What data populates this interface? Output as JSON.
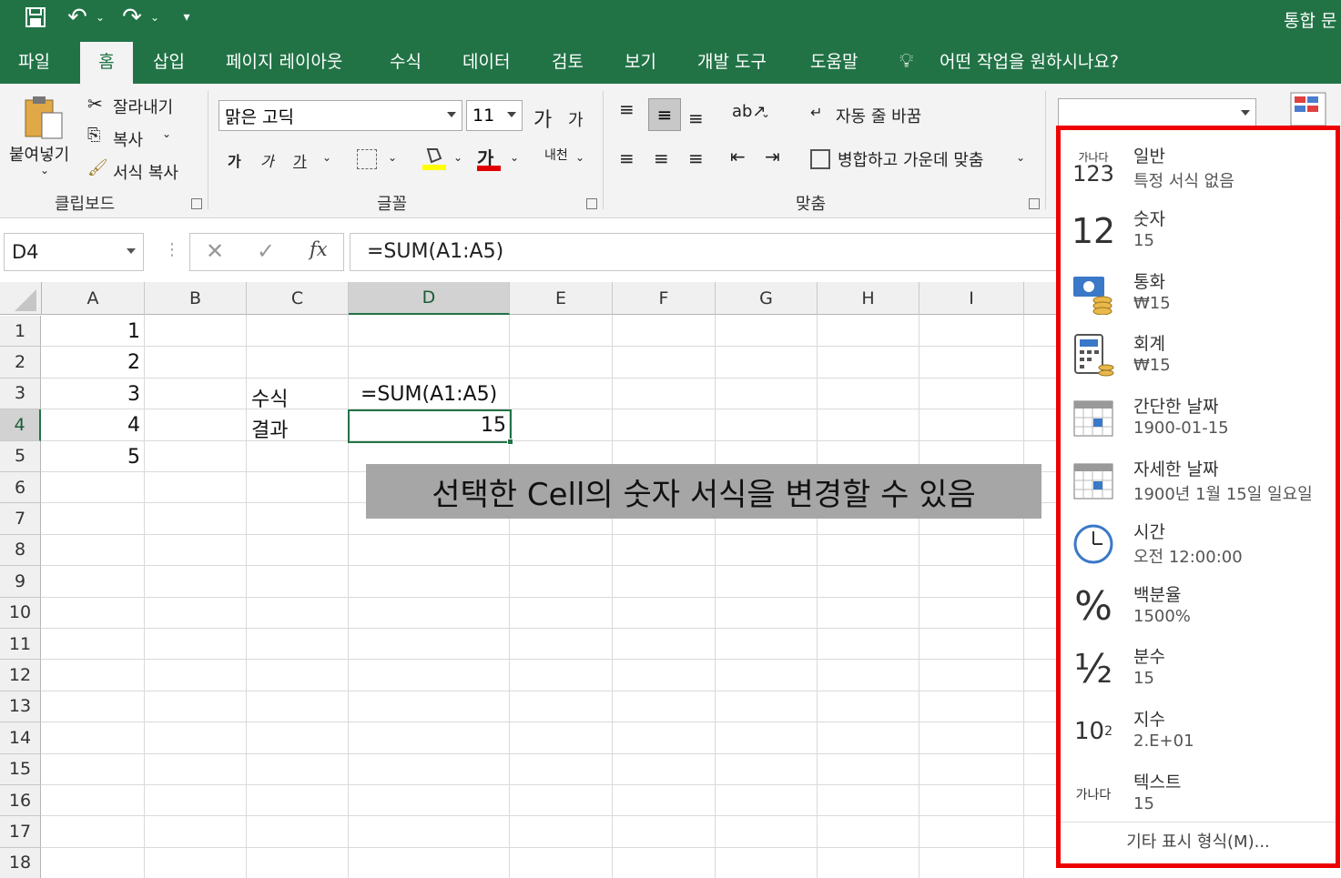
{
  "title_right": "통합 문",
  "tabs": [
    "파일",
    "홈",
    "삽입",
    "페이지 레이아웃",
    "수식",
    "데이터",
    "검토",
    "보기",
    "개발 도구",
    "도움말"
  ],
  "tell_me": "어떤 작업을 원하시나요?",
  "clipboard": {
    "paste": "붙여넣기",
    "cut": "잘라내기",
    "copy": "복사",
    "format_painter": "서식 복사",
    "group": "클립보드"
  },
  "font": {
    "name": "맑은 고딕",
    "size": "11",
    "grow": "가",
    "shrink": "가",
    "bold": "가",
    "italic": "가",
    "underline": "가",
    "color_letter": "가",
    "phonetic": "내천",
    "group": "글꼴"
  },
  "align": {
    "wrap": "자동 줄 바꿈",
    "merge": "병합하고 가운데 맞춤",
    "group": "맞춤"
  },
  "formula_bar": {
    "name_box": "D4",
    "fx": "fx",
    "formula": "=SUM(A1:A5)"
  },
  "columns": [
    "A",
    "B",
    "C",
    "D",
    "E",
    "F",
    "G",
    "H",
    "I"
  ],
  "rows": [
    "1",
    "2",
    "3",
    "4",
    "5",
    "6",
    "7",
    "8",
    "9",
    "10",
    "11",
    "12",
    "13",
    "14",
    "15",
    "16",
    "17",
    "18"
  ],
  "cells": {
    "a1": "1",
    "a2": "2",
    "a3": "3",
    "a4": "4",
    "a5": "5",
    "c3": "수식",
    "c4": "결과",
    "d3": "=SUM(A1:A5)",
    "d4": "15"
  },
  "annotation": "선택한 Cell의 숫자 서식을 변경할 수 있음",
  "number_formats": [
    {
      "name": "일반",
      "example": "특정 서식 없음",
      "icon": "general-icon",
      "glyph_top": "가나다",
      "glyph_bottom": "123"
    },
    {
      "name": "숫자",
      "example": "15",
      "icon": "number-icon",
      "glyph": "12"
    },
    {
      "name": "통화",
      "example": "₩15",
      "icon": "currency-icon"
    },
    {
      "name": "회계",
      "example": " ₩15",
      "icon": "accounting-icon"
    },
    {
      "name": "간단한 날짜",
      "example": "1900-01-15",
      "icon": "short-date-icon"
    },
    {
      "name": "자세한 날짜",
      "example": "1900년 1월 15일 일요일",
      "icon": "long-date-icon"
    },
    {
      "name": "시간",
      "example": "오전 12:00:00",
      "icon": "clock-icon"
    },
    {
      "name": "백분율",
      "example": "1500%",
      "icon": "percent-icon",
      "glyph": "%"
    },
    {
      "name": "분수",
      "example": "15",
      "icon": "fraction-icon",
      "glyph": "½"
    },
    {
      "name": "지수",
      "example": "2.E+01",
      "icon": "scientific-icon",
      "glyph": "10",
      "sup": "2"
    },
    {
      "name": "텍스트",
      "example": "15",
      "icon": "text-icon",
      "glyph": "가나다"
    }
  ],
  "more_formats": "기타 표시 형식(M)...",
  "colors": {
    "excel_green": "#217346",
    "highlight_border": "#ee0000",
    "annotation_bg": "#a6a6a6"
  }
}
